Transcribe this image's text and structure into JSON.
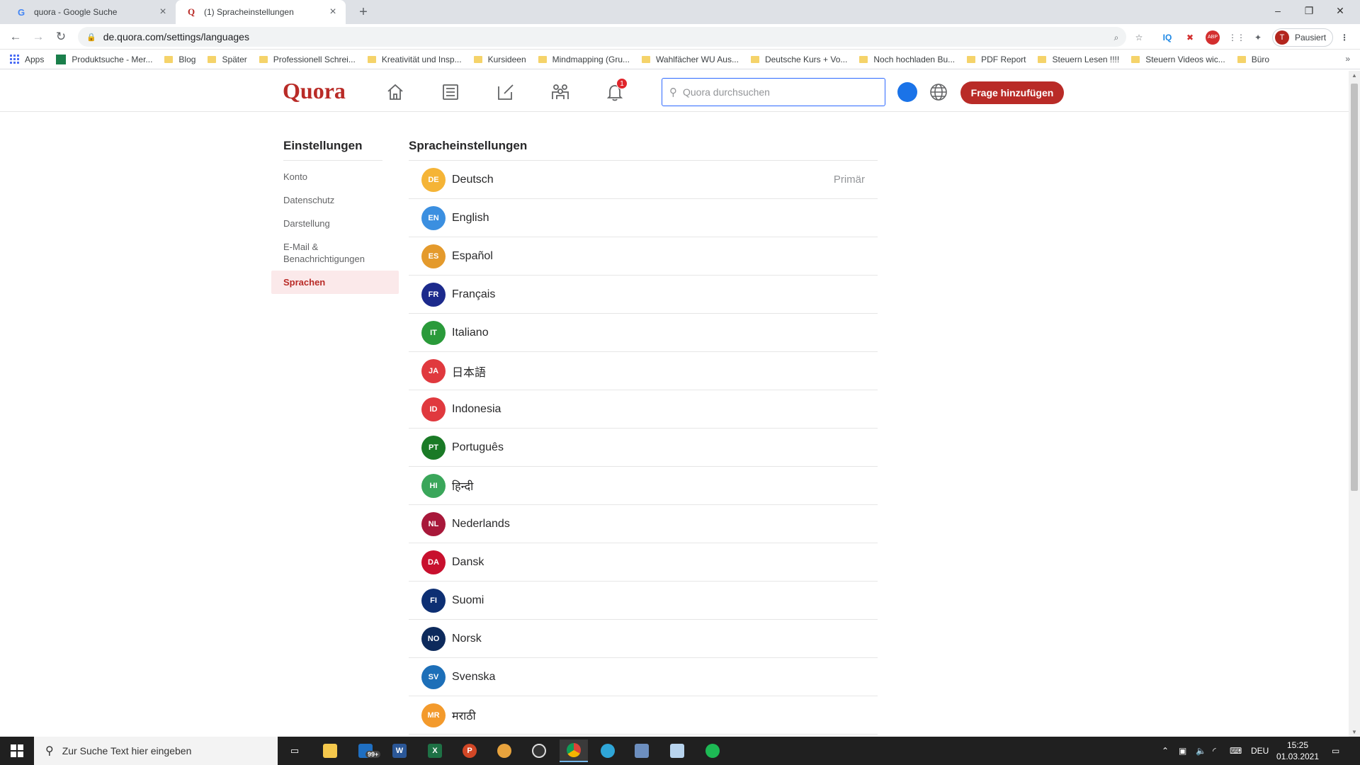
{
  "browser": {
    "tabs": [
      {
        "title": "quora - Google Suche",
        "favicon": "G",
        "active": false
      },
      {
        "title": "(1) Spracheinstellungen",
        "favicon": "Q",
        "active": true
      }
    ],
    "url": "de.quora.com/settings/languages",
    "profile_label": "Pausiert",
    "profile_initial": "T",
    "bookmarks": [
      {
        "label": "Apps",
        "icon": "apps-grid-icon"
      },
      {
        "label": "Produktsuche - Mer...",
        "icon": "page-icon"
      },
      {
        "label": "Blog",
        "icon": "folder-icon"
      },
      {
        "label": "Später",
        "icon": "folder-icon"
      },
      {
        "label": "Professionell Schrei...",
        "icon": "folder-icon"
      },
      {
        "label": "Kreativität und Insp...",
        "icon": "folder-icon"
      },
      {
        "label": "Kursideen",
        "icon": "folder-icon"
      },
      {
        "label": "Mindmapping (Gru...",
        "icon": "folder-icon"
      },
      {
        "label": "Wahlfächer WU Aus...",
        "icon": "folder-icon"
      },
      {
        "label": "Deutsche Kurs + Vo...",
        "icon": "folder-icon"
      },
      {
        "label": "Noch hochladen Bu...",
        "icon": "folder-icon"
      },
      {
        "label": "PDF Report",
        "icon": "folder-icon"
      },
      {
        "label": "Steuern Lesen !!!!",
        "icon": "folder-icon"
      },
      {
        "label": "Steuern Videos wic...",
        "icon": "folder-icon"
      },
      {
        "label": "Büro",
        "icon": "folder-icon"
      }
    ],
    "bookmarks_more": "»"
  },
  "quora": {
    "logo": "Quora",
    "notification_count": "1",
    "search_placeholder": "Quora durchsuchen",
    "ask_button": "Frage hinzufügen",
    "brand_color": "#b92b27"
  },
  "sidebar": {
    "title": "Einstellungen",
    "items": [
      {
        "label": "Konto",
        "active": false
      },
      {
        "label": "Datenschutz",
        "active": false
      },
      {
        "label": "Darstellung",
        "active": false
      },
      {
        "label": "E-Mail & Benachrichtigungen",
        "active": false
      },
      {
        "label": "Sprachen",
        "active": true
      }
    ]
  },
  "languages": {
    "title": "Spracheinstellungen",
    "primary_label": "Primär",
    "items": [
      {
        "code": "DE",
        "name": "Deutsch",
        "color": "#f5b436",
        "primary": true
      },
      {
        "code": "EN",
        "name": "English",
        "color": "#3b8fe0",
        "primary": false
      },
      {
        "code": "ES",
        "name": "Español",
        "color": "#e49a2c",
        "primary": false
      },
      {
        "code": "FR",
        "name": "Français",
        "color": "#1c2a8c",
        "primary": false
      },
      {
        "code": "IT",
        "name": "Italiano",
        "color": "#2a9a3a",
        "primary": false
      },
      {
        "code": "JA",
        "name": "日本語",
        "color": "#e0393e",
        "primary": false
      },
      {
        "code": "ID",
        "name": "Indonesia",
        "color": "#e0393e",
        "primary": false
      },
      {
        "code": "PT",
        "name": "Português",
        "color": "#1a7a26",
        "primary": false
      },
      {
        "code": "HI",
        "name": "हिन्दी",
        "color": "#3aa65a",
        "primary": false
      },
      {
        "code": "NL",
        "name": "Nederlands",
        "color": "#a8183a",
        "primary": false
      },
      {
        "code": "DA",
        "name": "Dansk",
        "color": "#c8102e",
        "primary": false
      },
      {
        "code": "FI",
        "name": "Suomi",
        "color": "#0d2f73",
        "primary": false
      },
      {
        "code": "NO",
        "name": "Norsk",
        "color": "#0d2a5c",
        "primary": false
      },
      {
        "code": "SV",
        "name": "Svenska",
        "color": "#1d6fb8",
        "primary": false
      },
      {
        "code": "MR",
        "name": "मराठी",
        "color": "#f39a2c",
        "primary": false
      }
    ]
  },
  "taskbar": {
    "search_placeholder": "Zur Suche Text hier eingeben",
    "mail_badge": "99+",
    "language": "DEU",
    "time": "15:25",
    "date": "01.03.2021"
  }
}
